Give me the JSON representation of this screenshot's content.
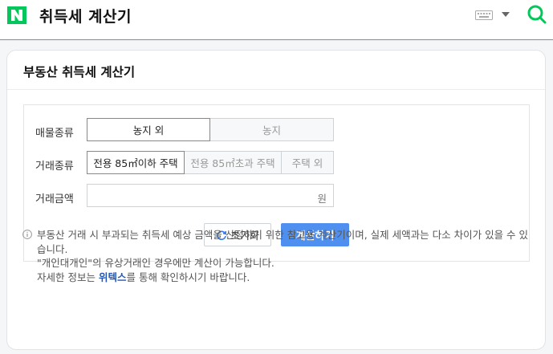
{
  "header": {
    "title": "취득세 계산기",
    "brand_color": "#03c75a"
  },
  "card": {
    "title": "부동산 취득세 계산기"
  },
  "form": {
    "property_type": {
      "label": "매물종류",
      "options": [
        "농지 외",
        "농지"
      ],
      "selected": "농지 외"
    },
    "deal_type": {
      "label": "거래종류",
      "options": [
        "전용 85㎡이하 주택",
        "전용 85㎡초과 주택",
        "주택 외"
      ],
      "selected": "전용 85㎡이하 주택"
    },
    "amount": {
      "label": "거래금액",
      "value": "",
      "unit": "원"
    },
    "reset_label": "초기화",
    "calc_label": "계산하기"
  },
  "notes": {
    "line1": "부동산 거래 시 부과되는 취득세 예상 금액을 산정하기 위한 참고용 계산기이며, 실제 세액과는 다소 차이가 있을 수 있습니다.",
    "line2": "\"개인대개인\"의 유상거래인 경우에만 계산이 가능합니다.",
    "line3_prefix": "자세한 정보는 ",
    "line3_link": "위텍스",
    "line3_suffix": "를 통해 확인하시기 바랍니다."
  }
}
